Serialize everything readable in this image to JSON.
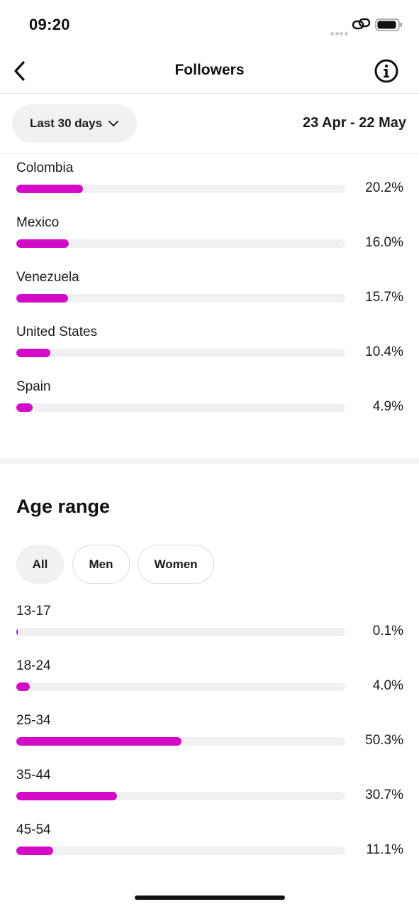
{
  "status_bar": {
    "time": "09:20",
    "icons": [
      "signal-dots-icon",
      "link-icon",
      "battery-icon"
    ]
  },
  "header": {
    "title": "Followers",
    "icons": [
      "back-chevron-icon",
      "info-icon"
    ]
  },
  "filter": {
    "range_label": "Last 30 days",
    "date_range": "23 Apr - 22 May",
    "icon": "chevron-down-icon"
  },
  "countries": [
    {
      "label": "Colombia",
      "value": "20.2%",
      "fraction": 0.202
    },
    {
      "label": "Mexico",
      "value": "16.0%",
      "fraction": 0.16
    },
    {
      "label": "Venezuela",
      "value": "15.7%",
      "fraction": 0.157
    },
    {
      "label": "United States",
      "value": "10.4%",
      "fraction": 0.104
    },
    {
      "label": "Spain",
      "value": "4.9%",
      "fraction": 0.049
    }
  ],
  "age_section": {
    "title": "Age range",
    "chips": [
      "All",
      "Men",
      "Women"
    ],
    "selected_chip": "All",
    "rows": [
      {
        "label": "13-17",
        "value": "0.1%",
        "fraction": 0.001
      },
      {
        "label": "18-24",
        "value": "4.0%",
        "fraction": 0.04
      },
      {
        "label": "25-34",
        "value": "50.3%",
        "fraction": 0.503
      },
      {
        "label": "35-44",
        "value": "30.7%",
        "fraction": 0.307
      },
      {
        "label": "45-54",
        "value": "11.1%",
        "fraction": 0.111
      }
    ]
  },
  "colors": {
    "bar_fill": "#d30bc8",
    "bar_track": "#f1f1f3",
    "chip_selected": "#f0f1f3"
  }
}
